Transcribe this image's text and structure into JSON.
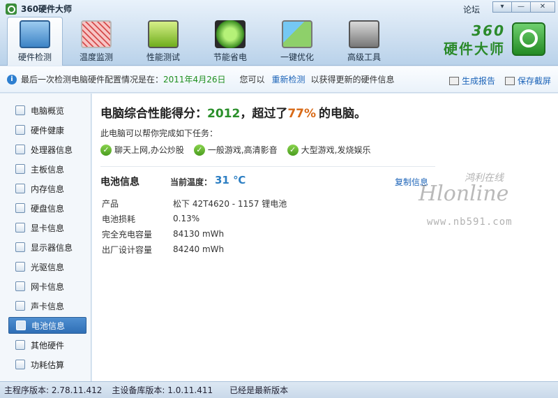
{
  "window": {
    "title": "360硬件大师",
    "forum_label": "论坛",
    "min": "▾",
    "minimize": "—",
    "close": "✕"
  },
  "tabs": [
    {
      "label": "硬件检测",
      "icon": "computer-icon",
      "active": true
    },
    {
      "label": "温度监测",
      "icon": "temperature-icon"
    },
    {
      "label": "性能测试",
      "icon": "performance-icon"
    },
    {
      "label": "节能省电",
      "icon": "power-icon"
    },
    {
      "label": "一键优化",
      "icon": "optimize-icon"
    },
    {
      "label": "高级工具",
      "icon": "tools-icon"
    }
  ],
  "brand": {
    "num": "360",
    "cn": "硬件大师"
  },
  "infobar": {
    "prefix": "最后一次检测电脑硬件配置情况是在：",
    "date": "2011年4月26日",
    "mid": "您可以",
    "recheck": "重新检测",
    "suffix": "以获得更新的硬件信息",
    "report": "生成报告",
    "screenshot": "保存截屏"
  },
  "sidebar": {
    "items": [
      {
        "label": "电脑概览"
      },
      {
        "label": "硬件健康"
      },
      {
        "label": "处理器信息"
      },
      {
        "label": "主板信息"
      },
      {
        "label": "内存信息"
      },
      {
        "label": "硬盘信息"
      },
      {
        "label": "显卡信息"
      },
      {
        "label": "显示器信息"
      },
      {
        "label": "光驱信息"
      },
      {
        "label": "网卡信息"
      },
      {
        "label": "声卡信息"
      },
      {
        "label": "电池信息",
        "active": true
      },
      {
        "label": "其他硬件"
      },
      {
        "label": "功耗估算"
      }
    ]
  },
  "main": {
    "score_prefix": "电脑综合性能得分：",
    "score": "2012",
    "score_mid": "，超过了",
    "percent": "77%",
    "score_suffix": "的电脑。",
    "sub": "此电脑可以帮你完成如下任务：",
    "tasks": [
      "聊天上网,办公炒股",
      "一般游戏,高清影音",
      "大型游戏,发烧娱乐"
    ],
    "battery_title": "电池信息",
    "temp_label": "当前温度：",
    "temp_value": "31 ℃",
    "copy": "复制信息",
    "rows": [
      {
        "k": "产品",
        "v": "松下 42T4620 -  1157 锂电池"
      },
      {
        "k": "电池损耗",
        "v": "0.13%"
      },
      {
        "k": "完全充电容量",
        "v": "84130 mWh"
      },
      {
        "k": "出厂设计容量",
        "v": "84240 mWh"
      }
    ]
  },
  "watermark": {
    "cn": "鸿利在线",
    "en": "Hlonline",
    "url": "www.nb591.com"
  },
  "status": {
    "main_version": "主程序版本: 2.78.11.412",
    "db_version": "主设备库版本: 1.0.11.411",
    "latest": "已经是最新版本"
  }
}
